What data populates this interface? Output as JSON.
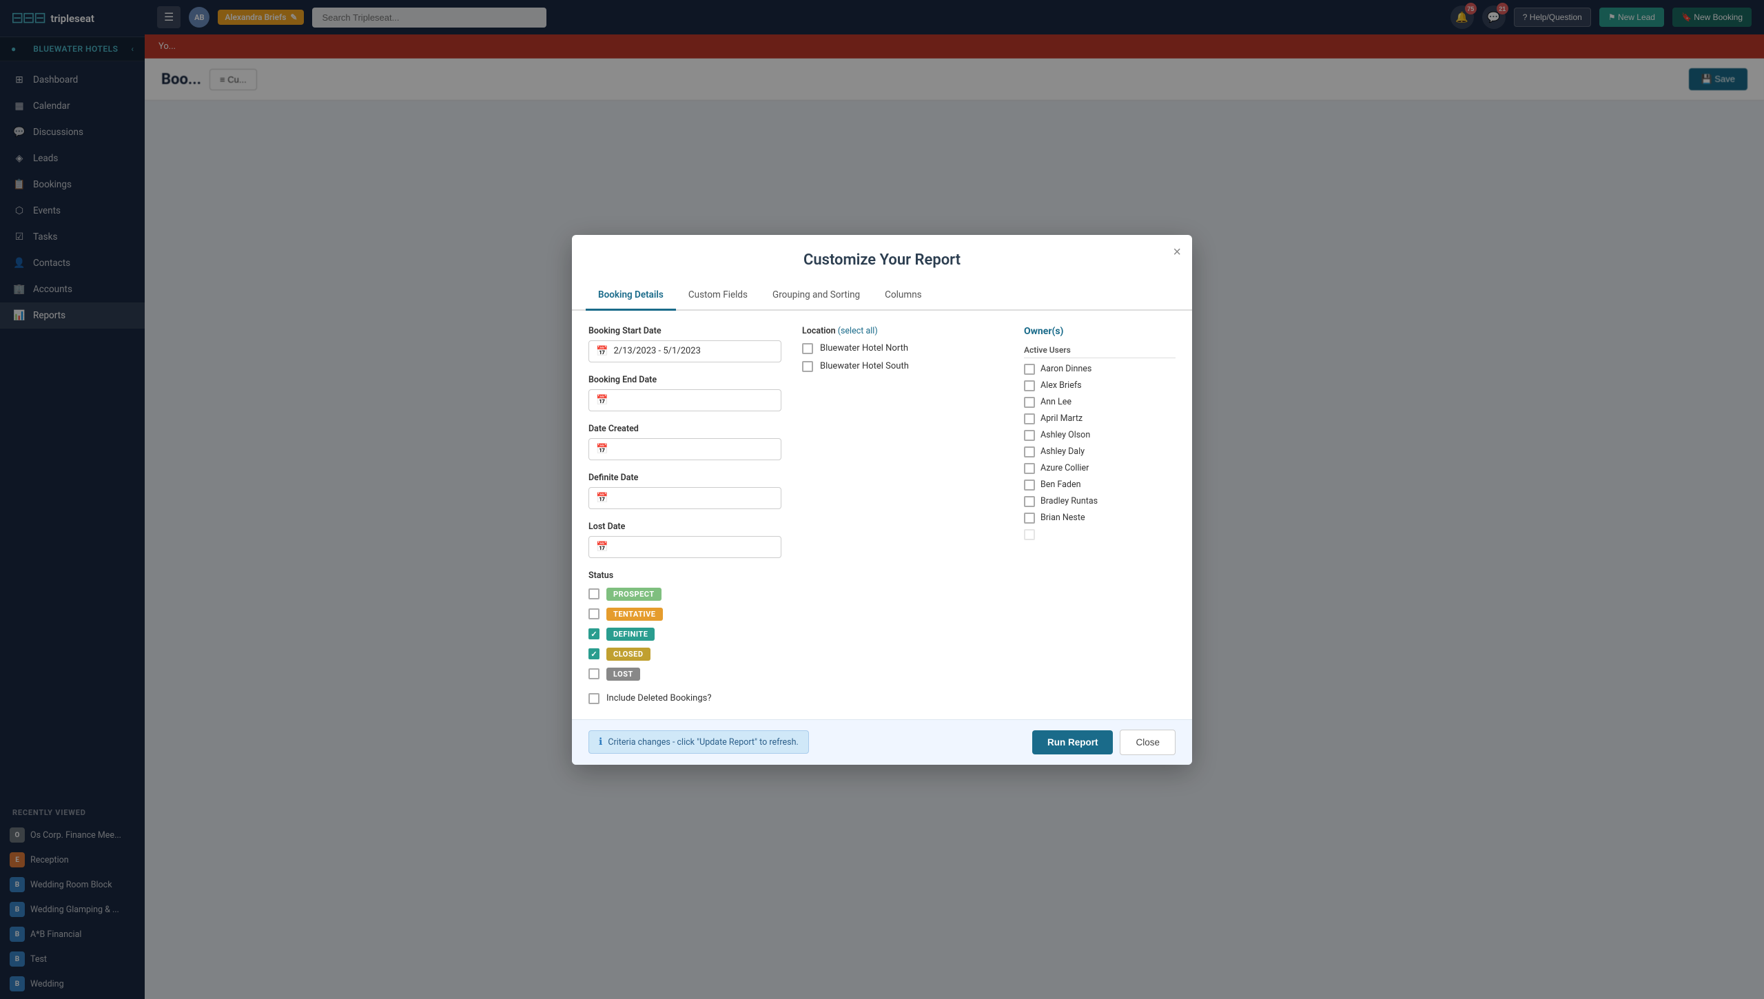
{
  "app": {
    "logo_icon": "⊡⊡⊡",
    "logo_text": "tripleseat"
  },
  "sidebar": {
    "location": "BLUEWATER HOTELS",
    "nav_items": [
      {
        "id": "dashboard",
        "label": "Dashboard",
        "icon": "⊞"
      },
      {
        "id": "calendar",
        "label": "Calendar",
        "icon": "📅"
      },
      {
        "id": "discussions",
        "label": "Discussions",
        "icon": "💬"
      },
      {
        "id": "leads",
        "label": "Leads",
        "icon": "◈"
      },
      {
        "id": "bookings",
        "label": "Bookings",
        "icon": "📋"
      },
      {
        "id": "events",
        "label": "Events",
        "icon": "⬡"
      },
      {
        "id": "tasks",
        "label": "Tasks",
        "icon": "☑"
      },
      {
        "id": "contacts",
        "label": "Contacts",
        "icon": "👤"
      },
      {
        "id": "accounts",
        "label": "Accounts",
        "icon": "🏢"
      },
      {
        "id": "reports",
        "label": "Reports",
        "icon": "📊"
      }
    ],
    "recently_viewed_label": "Recently Viewed",
    "recently_viewed": [
      {
        "id": "os-corp",
        "label": "Os Corp. Finance Mee...",
        "badge": "O",
        "color": "#6c757d"
      },
      {
        "id": "reception",
        "label": "Reception",
        "badge": "E",
        "color": "#e07b39"
      },
      {
        "id": "wedding-room",
        "label": "Wedding Room Block",
        "badge": "B",
        "color": "#3a86c8"
      },
      {
        "id": "wedding-glamping",
        "label": "Wedding Glamping & ...",
        "badge": "B",
        "color": "#3a86c8"
      },
      {
        "id": "ab-financial",
        "label": "A*B Financial",
        "badge": "B",
        "color": "#3a86c8"
      },
      {
        "id": "test",
        "label": "Test",
        "badge": "B",
        "color": "#3a86c8"
      },
      {
        "id": "wedding",
        "label": "Wedding",
        "badge": "B",
        "color": "#3a86c8"
      }
    ]
  },
  "topbar": {
    "user_initials": "AB",
    "user_name": "Alexandra Briefs",
    "search_placeholder": "Search Tripleseat...",
    "notif1_count": "75",
    "notif2_count": "21",
    "help_label": "Help/Question",
    "new_lead_label": "New Lead",
    "new_booking_label": "New Booking"
  },
  "page": {
    "title": "Boo...",
    "alert_text": "Yo...",
    "customize_btn": "Cu...",
    "save_btn": "Save"
  },
  "modal": {
    "title": "Customize Your Report",
    "close_icon": "×",
    "tabs": [
      {
        "id": "booking-details",
        "label": "Booking Details",
        "active": true
      },
      {
        "id": "custom-fields",
        "label": "Custom Fields",
        "active": false
      },
      {
        "id": "grouping-sorting",
        "label": "Grouping and Sorting",
        "active": false
      },
      {
        "id": "columns",
        "label": "Columns",
        "active": false
      }
    ],
    "booking_start_date_label": "Booking Start Date",
    "booking_start_date_value": "2/13/2023 - 5/1/2023",
    "booking_end_date_label": "Booking End Date",
    "booking_end_date_placeholder": "",
    "date_created_label": "Date Created",
    "date_created_placeholder": "",
    "definite_date_label": "Definite Date",
    "definite_date_placeholder": "",
    "lost_date_label": "Lost Date",
    "lost_date_placeholder": "",
    "status_label": "Status",
    "statuses": [
      {
        "id": "prospect",
        "label": "PROSPECT",
        "checked": false,
        "badge_class": "badge-prospect"
      },
      {
        "id": "tentative",
        "label": "TENTATIVE",
        "checked": false,
        "badge_class": "badge-tentative"
      },
      {
        "id": "definite",
        "label": "DEFINITE",
        "checked": true,
        "badge_class": "badge-definite"
      },
      {
        "id": "closed",
        "label": "CLOSED",
        "checked": true,
        "badge_class": "badge-closed"
      },
      {
        "id": "lost",
        "label": "LOST",
        "checked": false,
        "badge_class": "badge-lost"
      }
    ],
    "include_deleted_label": "Include Deleted Bookings?",
    "include_deleted_checked": false,
    "location_label": "Location",
    "location_select_all": "(select all)",
    "locations": [
      {
        "id": "bluewater-north",
        "label": "Bluewater Hotel North",
        "checked": false
      },
      {
        "id": "bluewater-south",
        "label": "Bluewater Hotel South",
        "checked": false
      }
    ],
    "owner_title": "Owner(s)",
    "active_users_label": "Active Users",
    "owners": [
      {
        "id": "aaron",
        "label": "Aaron Dinnes",
        "checked": false
      },
      {
        "id": "alex",
        "label": "Alex Briefs",
        "checked": false
      },
      {
        "id": "ann",
        "label": "Ann Lee",
        "checked": false
      },
      {
        "id": "april",
        "label": "April Martz",
        "checked": false
      },
      {
        "id": "ashley-o",
        "label": "Ashley Olson",
        "checked": false
      },
      {
        "id": "ashley-d",
        "label": "Ashley Daly",
        "checked": false
      },
      {
        "id": "azure",
        "label": "Azure Collier",
        "checked": false
      },
      {
        "id": "ben",
        "label": "Ben Faden",
        "checked": false
      },
      {
        "id": "bradley",
        "label": "Bradley Runtas",
        "checked": false
      },
      {
        "id": "brian",
        "label": "Brian Neste",
        "checked": false
      }
    ],
    "footer_info": "Criteria changes - click \"Update Report\" to refresh.",
    "run_report_label": "Run Report",
    "close_label": "Close"
  }
}
